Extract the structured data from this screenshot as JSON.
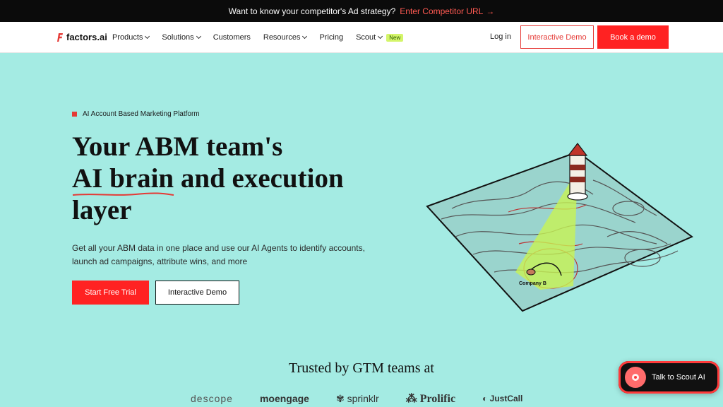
{
  "announcement": {
    "text": "Want to know your competitor's Ad strategy?",
    "cta": "Enter Competitor URL"
  },
  "nav": {
    "brand": "factors.ai",
    "items": [
      {
        "label": "Products",
        "dropdown": true
      },
      {
        "label": "Solutions",
        "dropdown": true
      },
      {
        "label": "Customers",
        "dropdown": false
      },
      {
        "label": "Resources",
        "dropdown": true
      },
      {
        "label": "Pricing",
        "dropdown": false
      },
      {
        "label": "Scout",
        "dropdown": true,
        "badge": "New"
      }
    ],
    "login": "Log in",
    "demo": "Interactive Demo",
    "book": "Book a demo"
  },
  "hero": {
    "eyebrow": "AI Account Based Marketing Platform",
    "headline_1": "Your ABM team's",
    "headline_2a": "AI brain",
    "headline_2b": " and execution",
    "headline_3": "layer",
    "description": "Get all your ABM data in one place and use our AI Agents to identify accounts, launch ad campaigns, attribute wins, and more",
    "primary_cta": "Start Free Trial",
    "secondary_cta": "Interactive Demo",
    "map_label": "Company B"
  },
  "trusted": {
    "title": "Trusted by GTM teams at",
    "logos": [
      "descope",
      "moengage",
      "sprinklr",
      "Prolific",
      "JustCall"
    ]
  },
  "scout_widget": {
    "label": "Talk to Scout AI"
  },
  "colors": {
    "accent": "#ff2222",
    "background": "#a4ebe3",
    "dark": "#0b0b0b",
    "badge": "#d4f56a"
  }
}
